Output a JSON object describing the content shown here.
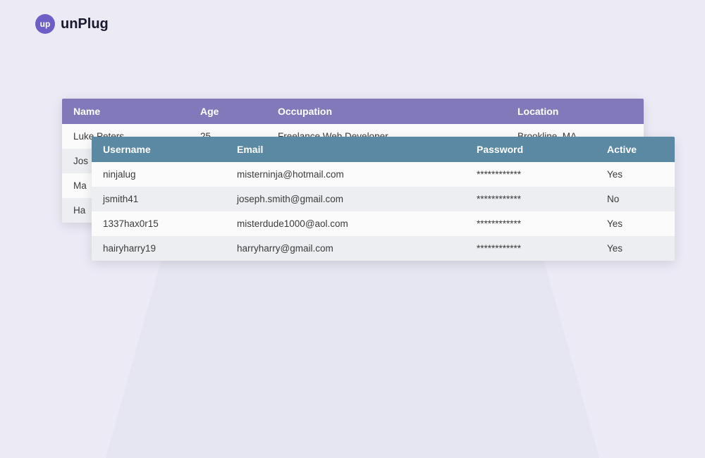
{
  "logo": {
    "badge": "up",
    "text": "unPlug"
  },
  "table1": {
    "headers": {
      "name": "Name",
      "age": "Age",
      "occupation": "Occupation",
      "location": "Location"
    },
    "rows": [
      {
        "name": "Luke Peters",
        "age": "25",
        "occupation": "Freelance Web Developer",
        "location": "Brookline, MA"
      },
      {
        "name": "Jos",
        "age": "",
        "occupation": "",
        "location": ""
      },
      {
        "name": "Ma",
        "age": "",
        "occupation": "",
        "location": ""
      },
      {
        "name": "Ha",
        "age": "",
        "occupation": "",
        "location": ""
      }
    ]
  },
  "table2": {
    "headers": {
      "username": "Username",
      "email": "Email",
      "password": "Password",
      "active": "Active"
    },
    "rows": [
      {
        "username": "ninjalug",
        "email": "misterninja@hotmail.com",
        "password": "************",
        "active": "Yes"
      },
      {
        "username": "jsmith41",
        "email": "joseph.smith@gmail.com",
        "password": "************",
        "active": "No"
      },
      {
        "username": "1337hax0r15",
        "email": "misterdude1000@aol.com",
        "password": "************",
        "active": "Yes"
      },
      {
        "username": "hairyharry19",
        "email": "harryharry@gmail.com",
        "password": "************",
        "active": "Yes"
      }
    ]
  }
}
